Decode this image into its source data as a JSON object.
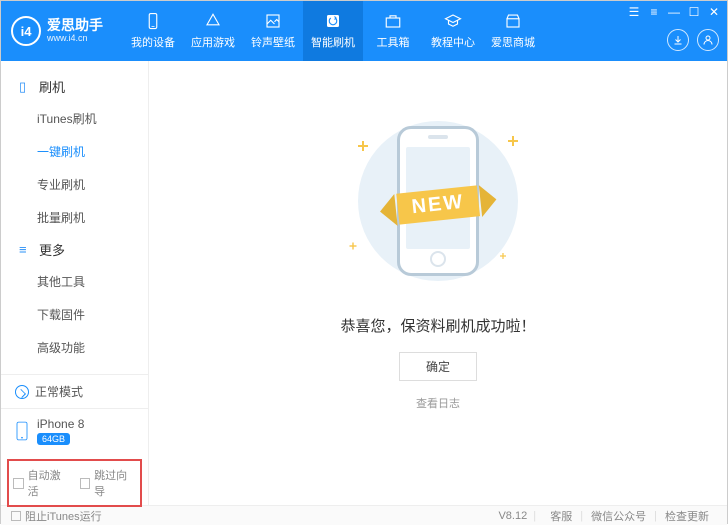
{
  "brand": {
    "name": "爱思助手",
    "url": "www.i4.cn",
    "logo_text": "i4"
  },
  "tabs": [
    {
      "label": "我的设备"
    },
    {
      "label": "应用游戏"
    },
    {
      "label": "铃声壁纸"
    },
    {
      "label": "智能刷机"
    },
    {
      "label": "工具箱"
    },
    {
      "label": "教程中心"
    },
    {
      "label": "爱思商城"
    }
  ],
  "sidebar": {
    "group1": {
      "title": "刷机",
      "items": [
        "iTunes刷机",
        "一键刷机",
        "专业刷机",
        "批量刷机"
      ]
    },
    "group2": {
      "title": "更多",
      "items": [
        "其他工具",
        "下载固件",
        "高级功能"
      ]
    }
  },
  "mode": {
    "label": "正常模式"
  },
  "device": {
    "name": "iPhone 8",
    "storage": "64GB"
  },
  "options": {
    "auto_activate": "自动激活",
    "skip_wizard": "跳过向导"
  },
  "main": {
    "ribbon": "NEW",
    "success": "恭喜您，保资料刷机成功啦！",
    "confirm": "确定",
    "view_log": "查看日志"
  },
  "footer": {
    "block_itunes": "阻止iTunes运行",
    "version": "V8.12",
    "support": "客服",
    "wechat": "微信公众号",
    "update": "检查更新"
  }
}
